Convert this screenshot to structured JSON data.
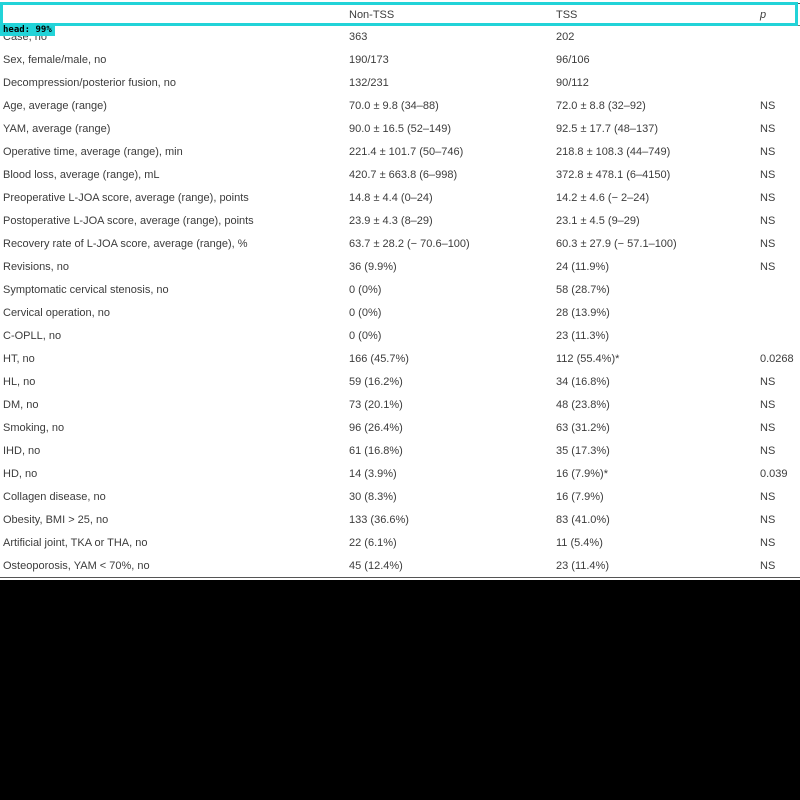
{
  "table": {
    "header": {
      "label": "",
      "col1": "Non-TSS",
      "col2": "TSS",
      "col3": "p"
    },
    "rows": [
      {
        "label": "Case, no",
        "nontss": "363",
        "tss": "202",
        "p": ""
      },
      {
        "label": "Sex, female/male, no",
        "nontss": "190/173",
        "tss": "96/106",
        "p": ""
      },
      {
        "label": "Decompression/posterior fusion, no",
        "nontss": "132/231",
        "tss": "90/112",
        "p": ""
      },
      {
        "label": "Age, average (range)",
        "nontss": "70.0 ± 9.8 (34–88)",
        "tss": "72.0 ± 8.8 (32–92)",
        "p": "NS"
      },
      {
        "label": "YAM, average (range)",
        "nontss": "90.0 ± 16.5 (52–149)",
        "tss": "92.5 ± 17.7 (48–137)",
        "p": "NS"
      },
      {
        "label": "Operative time, average (range), min",
        "nontss": "221.4 ± 101.7 (50–746)",
        "tss": "218.8 ± 108.3 (44–749)",
        "p": "NS"
      },
      {
        "label": "Blood loss, average (range), mL",
        "nontss": "420.7 ± 663.8 (6–998)",
        "tss": "372.8 ± 478.1 (6–4150)",
        "p": "NS"
      },
      {
        "label": "Preoperative L-JOA score, average (range), points",
        "nontss": "14.8 ± 4.4 (0–24)",
        "tss": "14.2 ± 4.6 (− 2–24)",
        "p": "NS"
      },
      {
        "label": "Postoperative L-JOA score, average (range), points",
        "nontss": "23.9 ± 4.3 (8–29)",
        "tss": "23.1 ± 4.5 (9–29)",
        "p": "NS"
      },
      {
        "label": "Recovery rate of L-JOA score, average (range), %",
        "nontss": "63.7 ± 28.2 (− 70.6–100)",
        "tss": "60.3 ± 27.9 (− 57.1–100)",
        "p": "NS"
      },
      {
        "label": "Revisions, no",
        "nontss": "36 (9.9%)",
        "tss": "24 (11.9%)",
        "p": "NS"
      },
      {
        "label": "Symptomatic cervical stenosis, no",
        "nontss": "0 (0%)",
        "tss": "58 (28.7%)",
        "p": ""
      },
      {
        "label": "Cervical operation, no",
        "nontss": "0 (0%)",
        "tss": "28 (13.9%)",
        "p": ""
      },
      {
        "label": "C-OPLL, no",
        "nontss": "0 (0%)",
        "tss": "23 (11.3%)",
        "p": ""
      },
      {
        "label": "HT, no",
        "nontss": "166 (45.7%)",
        "tss": "112 (55.4%)*",
        "p": "0.0268"
      },
      {
        "label": "HL, no",
        "nontss": "59 (16.2%)",
        "tss": "34 (16.8%)",
        "p": "NS"
      },
      {
        "label": "DM, no",
        "nontss": "73 (20.1%)",
        "tss": "48 (23.8%)",
        "p": "NS"
      },
      {
        "label": "Smoking, no",
        "nontss": "96 (26.4%)",
        "tss": "63 (31.2%)",
        "p": "NS"
      },
      {
        "label": "IHD, no",
        "nontss": "61 (16.8%)",
        "tss": "35 (17.3%)",
        "p": "NS"
      },
      {
        "label": "HD, no",
        "nontss": "14 (3.9%)",
        "tss": "16 (7.9%)*",
        "p": "0.039"
      },
      {
        "label": "Collagen disease, no",
        "nontss": "30 (8.3%)",
        "tss": "16 (7.9%)",
        "p": "NS"
      },
      {
        "label": "Obesity, BMI > 25, no",
        "nontss": "133 (36.6%)",
        "tss": "83 (41.0%)",
        "p": "NS"
      },
      {
        "label": "Artificial joint, TKA or THA, no",
        "nontss": "22 (6.1%)",
        "tss": "11 (5.4%)",
        "p": "NS"
      },
      {
        "label": "Osteoporosis, YAM < 70%, no",
        "nontss": "45 (12.4%)",
        "tss": "23 (11.4%)",
        "p": "NS"
      }
    ]
  },
  "detection": {
    "label": "head: 99%",
    "color": "#22d3d8"
  }
}
